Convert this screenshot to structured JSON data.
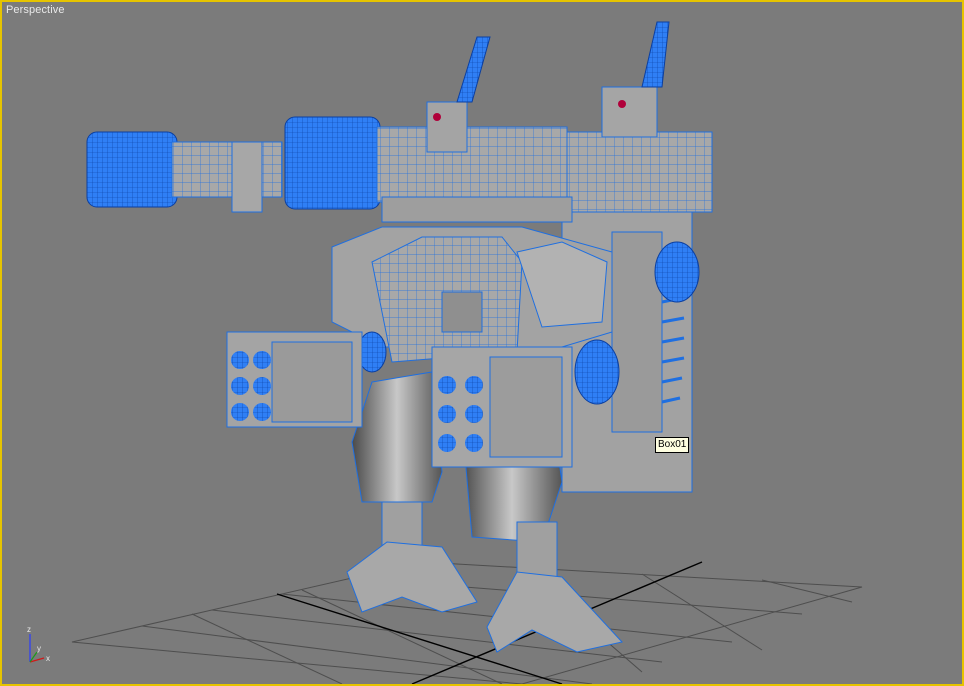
{
  "viewport": {
    "label": "Perspective",
    "border_color": "#e6c400",
    "background": "#7b7b7b"
  },
  "selection_tooltip": {
    "text": "Box01"
  },
  "axis_gizmo": {
    "z_label": "z",
    "x_label": "x",
    "y_label": "y"
  },
  "colors": {
    "wire_blue": "#1f6fe0",
    "dense_wire": "#2f7ff5",
    "surface": "#9e9e9e",
    "grid": "#4e4e4e",
    "grid_axis": "#000000",
    "accent_red": "#b0003a"
  }
}
